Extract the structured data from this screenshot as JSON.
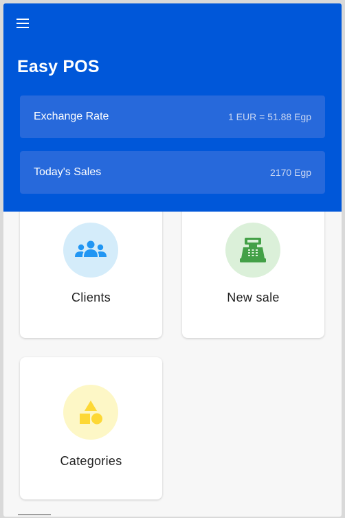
{
  "app": {
    "title": "Easy POS"
  },
  "toolbar": {
    "menu_icon": "hamburger-menu-icon"
  },
  "summary": {
    "exchange_rate": {
      "label": "Exchange Rate",
      "value": "1 EUR = 51.88 Egp"
    },
    "todays_sales": {
      "label": "Today's Sales",
      "value": "2170 Egp"
    }
  },
  "tiles": [
    {
      "label": "Clients",
      "icon": "people-group-icon",
      "color": "#2196f3",
      "bg": "#d4ecfa"
    },
    {
      "label": "New sale",
      "icon": "cash-register-icon",
      "color": "#43a047",
      "bg": "#dbf0d9"
    },
    {
      "label": "Categories",
      "icon": "shapes-icon",
      "color": "#fdd835",
      "bg": "#fdf7c6"
    }
  ],
  "colors": {
    "primary": "#0057d9",
    "card": "#2769db",
    "background": "#f7f7f7"
  }
}
